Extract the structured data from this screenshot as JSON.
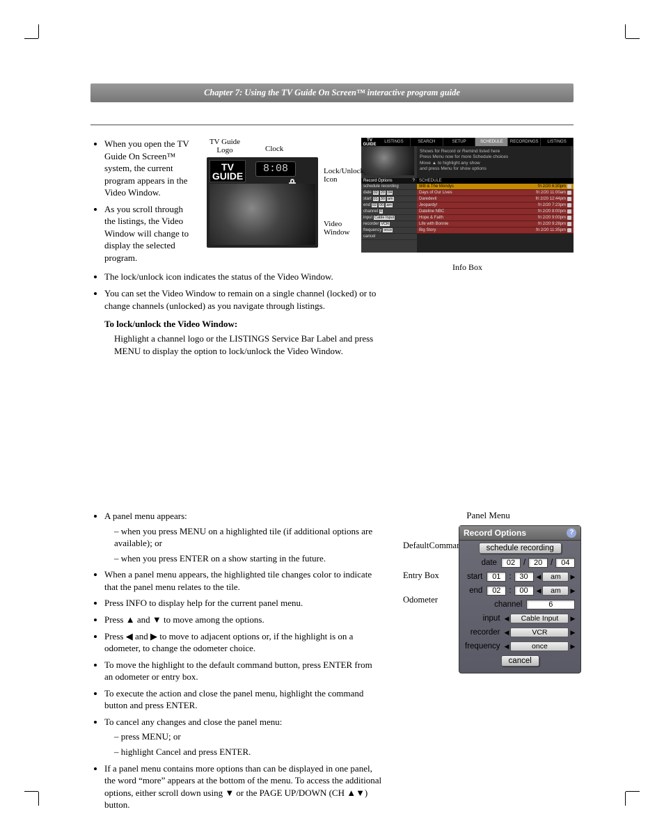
{
  "header": {
    "chapter_title": "Chapter 7: Using the TV Guide On Screen™ interactive program guide"
  },
  "section1": {
    "bullets": [
      "When you open the TV Guide On Screen™ system, the current program appears in the Video Window.",
      "As you scroll through the listings, the Video Window will change to display the selected program.",
      "The lock/unlock icon indicates the status of the Video Window.",
      "You can set the Video Window to remain on a single channel (locked) or to change channels (unlocked) as you navigate through listings."
    ],
    "bold_line": "To lock/unlock the Video Window:",
    "instruction": "Highlight a channel logo or the LISTINGS Service Bar Label and press MENU to display the option to lock/unlock the Video Window."
  },
  "fig1": {
    "labels": {
      "logo": "TV Guide\nLogo",
      "clock": "Clock",
      "lock": "Lock/Unlock\nIcon",
      "video": "Video\nWindow"
    },
    "tvguide_text": "TV\nGUIDE",
    "clock_value": "8:08"
  },
  "fig2": {
    "tabs": [
      "LISTINGS",
      "SEARCH",
      "SETUP",
      "SCHEDULE",
      "RECORDINGS",
      "LISTINGS"
    ],
    "active_tab_index": 3,
    "logo_text": "TV\nGUIDE",
    "info_lines": [
      "Shows for Record or Remind listed here",
      "Press Menu now for more Schedule choices",
      "Move ▲ to highlight any show",
      "and press Menu for show options"
    ],
    "left_header": "Record Options",
    "left_rows": [
      {
        "label": "schedule recording",
        "fields": []
      },
      {
        "label": "date",
        "fields": [
          "02",
          "20",
          "04"
        ]
      },
      {
        "label": "start",
        "fields": [
          "01",
          "30",
          "am"
        ]
      },
      {
        "label": "end",
        "fields": [
          "02",
          "00",
          "am"
        ]
      },
      {
        "label": "channel",
        "fields": [
          "6"
        ]
      },
      {
        "label": "input",
        "fields": [
          "Cable Input"
        ]
      },
      {
        "label": "recorder",
        "fields": [
          "VCR"
        ]
      },
      {
        "label": "frequency",
        "fields": [
          "once"
        ]
      },
      {
        "label": "cancel",
        "fields": []
      }
    ],
    "right_header": "SCHEDULE",
    "right_rows": [
      {
        "title": "Will & The Mondys",
        "time": "fri 2/20  6:30pm"
      },
      {
        "title": "Days of Our Lives",
        "time": "fri 2/20 11:00am"
      },
      {
        "title": "Daredevil",
        "time": "fri 2/20 12:44pm"
      },
      {
        "title": "Jeopardy!",
        "time": "fri 2/20  7:23pm"
      },
      {
        "title": "Dateline NBC",
        "time": "fri 2/20  8:00pm"
      },
      {
        "title": "Hope & Faith",
        "time": "fri 2/20  9:00pm"
      },
      {
        "title": "Life with Bonnie",
        "time": "fri 2/20  9:28pm"
      },
      {
        "title": "Big Story",
        "time": "fri 2/20 11:35pm"
      }
    ],
    "info_box_label": "Info Box"
  },
  "section2": {
    "b1": "A panel menu appears:",
    "b1_subs": [
      "when you press MENU on a highlighted tile (if additional options are available); or",
      "when you press ENTER on a show starting in the future."
    ],
    "b2": "When a panel menu appears, the highlighted tile changes color to indicate that the panel menu relates to the tile.",
    "b3": "Press INFO to display help for the current panel menu.",
    "b4": "Press ▲ and ▼  to move among the options.",
    "b5": "Press ◀ and ▶ to move to adjacent options or, if the highlight is on a odometer, to change the odometer choice.",
    "b6": "To move the highlight to the default command button, press ENTER from an odometer or entry box.",
    "b7": "To execute the action and close the panel menu, highlight the command button and press ENTER.",
    "b8": "To cancel any changes and close the panel menu:",
    "b8_subs": [
      "press MENU; or",
      "highlight Cancel and press ENTER."
    ],
    "b9": "If a panel menu contains more options than can be displayed in one panel, the word “more” appears at the bottom of the menu. To access the additional options, either scroll down using ▼ or the PAGE UP/DOWN (CH ▲▼) button."
  },
  "panel": {
    "menu_label": "Panel Menu",
    "side_labels": {
      "default_cmd": "Default\nCommand\nButton",
      "entry_box": "Entry Box",
      "odometer": "Odometer"
    },
    "header": "Record Options",
    "rows": {
      "schedule_btn": "schedule recording",
      "date_label": "date",
      "date_m": "02",
      "date_d": "20",
      "date_y": "04",
      "start_label": "start",
      "start_h": "01",
      "start_m": "30",
      "start_ampm": "am",
      "end_label": "end",
      "end_h": "02",
      "end_m": "00",
      "end_ampm": "am",
      "channel_label": "channel",
      "channel_val": "6",
      "input_label": "input",
      "input_val": "Cable Input",
      "recorder_label": "recorder",
      "recorder_val": "VCR",
      "frequency_label": "frequency",
      "frequency_val": "once",
      "cancel": "cancel"
    }
  }
}
